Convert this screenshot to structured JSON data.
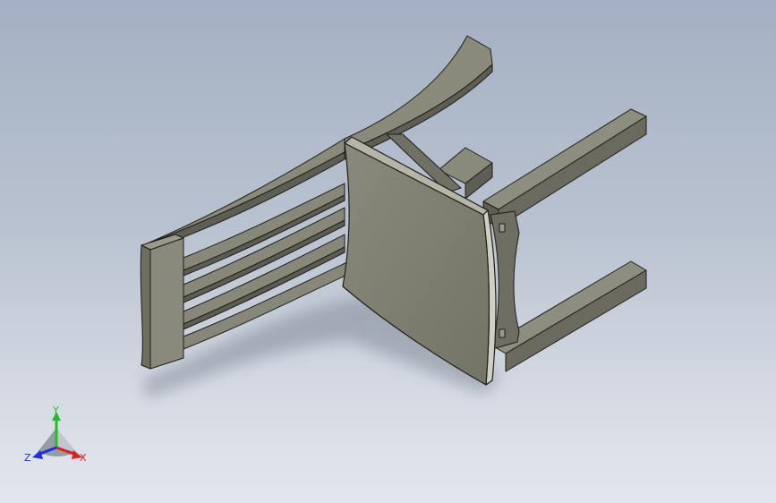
{
  "viewport": {
    "background_top": "#a4b0c3",
    "background_bottom": "#e3e6ec",
    "model": "chair",
    "model_color": "#7c7c6e",
    "edge_color": "#1e1e1a"
  },
  "triad": {
    "x_label": "X",
    "y_label": "Y",
    "z_label": "Z",
    "x_color": "#e02020",
    "y_color": "#20c020",
    "z_color": "#2030e0"
  }
}
